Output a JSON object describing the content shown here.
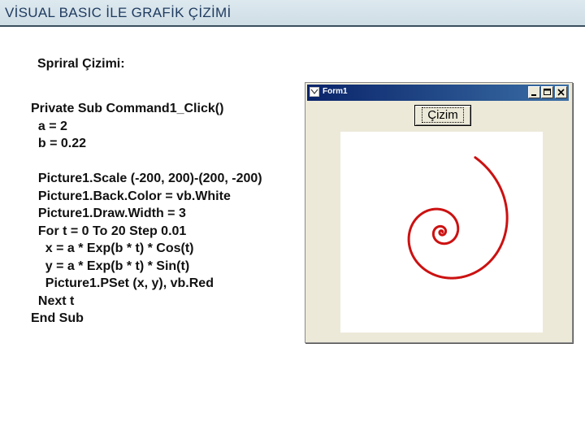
{
  "slide": {
    "title": "VİSUAL BASIC İLE GRAFİK ÇİZİMİ",
    "subtitle": "Spriral Çizimi:"
  },
  "code_lines": [
    "Private Sub Command1_Click()",
    "  a = 2",
    "  b = 0.22",
    "",
    "  Picture1.Scale (-200, 200)-(200, -200)",
    "  Picture1.Back.Color = vb.White",
    "  Picture1.Draw.Width = 3",
    "  For t = 0 To 20 Step 0.01",
    "    x = a * Exp(b * t) * Cos(t)",
    "    y = a * Exp(b * t) * Sin(t)",
    "    Picture1.PSet (x, y), vb.Red",
    "  Next t",
    "End Sub"
  ],
  "form": {
    "title": "Form1",
    "button_label": "Çizim",
    "colors": {
      "titlebar": "#0a246a",
      "face": "#ece9d8",
      "spiral": "#cc1111"
    }
  },
  "spiral": {
    "a": 2,
    "b": 0.22,
    "t_start": 0,
    "t_end": 20,
    "step": 0.01,
    "scale_min": -200,
    "scale_max": 200
  }
}
